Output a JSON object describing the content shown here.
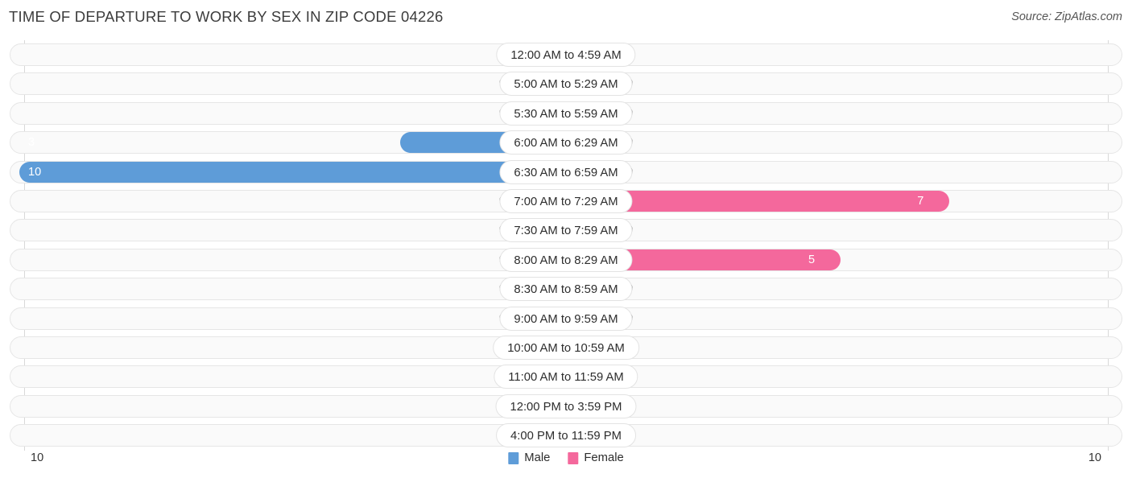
{
  "header": {
    "title": "TIME OF DEPARTURE TO WORK BY SEX IN ZIP CODE 04226",
    "source": "Source: ZipAtlas.com"
  },
  "legend": {
    "items": [
      {
        "label": "Male",
        "color": "#5e9cd8"
      },
      {
        "label": "Female",
        "color": "#f4689c"
      }
    ]
  },
  "axis": {
    "left_tick": "10",
    "right_tick": "10"
  },
  "colors": {
    "male_light": "#aecbee",
    "male_dark": "#5e9cd8",
    "female_light": "#f9aec8",
    "female_dark": "#f4689c",
    "track": "#fafafa",
    "track_border": "#e6e6e6"
  },
  "chart_data": {
    "type": "bar",
    "title": "TIME OF DEPARTURE TO WORK BY SEX IN ZIP CODE 04226",
    "orientation": "horizontal-diverging",
    "xlabel": "",
    "ylabel": "",
    "xlim": [
      10,
      10
    ],
    "grid": false,
    "legend_position": "bottom-center",
    "categories": [
      "12:00 AM to 4:59 AM",
      "5:00 AM to 5:29 AM",
      "5:30 AM to 5:59 AM",
      "6:00 AM to 6:29 AM",
      "6:30 AM to 6:59 AM",
      "7:00 AM to 7:29 AM",
      "7:30 AM to 7:59 AM",
      "8:00 AM to 8:29 AM",
      "8:30 AM to 8:59 AM",
      "9:00 AM to 9:59 AM",
      "10:00 AM to 10:59 AM",
      "11:00 AM to 11:59 AM",
      "12:00 PM to 3:59 PM",
      "4:00 PM to 11:59 PM"
    ],
    "series": [
      {
        "name": "Male",
        "values": [
          0,
          0,
          0,
          3,
          10,
          0,
          0,
          0,
          0,
          0,
          0,
          0,
          0,
          0
        ]
      },
      {
        "name": "Female",
        "values": [
          0,
          0,
          0,
          0,
          0,
          7,
          0,
          5,
          0,
          0,
          0,
          0,
          0,
          0
        ]
      }
    ]
  },
  "rows": [
    {
      "label": "12:00 AM to 4:59 AM",
      "male": "0",
      "female": "0"
    },
    {
      "label": "5:00 AM to 5:29 AM",
      "male": "0",
      "female": "0"
    },
    {
      "label": "5:30 AM to 5:59 AM",
      "male": "0",
      "female": "0"
    },
    {
      "label": "6:00 AM to 6:29 AM",
      "male": "3",
      "female": "0"
    },
    {
      "label": "6:30 AM to 6:59 AM",
      "male": "10",
      "female": "0"
    },
    {
      "label": "7:00 AM to 7:29 AM",
      "male": "0",
      "female": "7"
    },
    {
      "label": "7:30 AM to 7:59 AM",
      "male": "0",
      "female": "0"
    },
    {
      "label": "8:00 AM to 8:29 AM",
      "male": "0",
      "female": "5"
    },
    {
      "label": "8:30 AM to 8:59 AM",
      "male": "0",
      "female": "0"
    },
    {
      "label": "9:00 AM to 9:59 AM",
      "male": "0",
      "female": "0"
    },
    {
      "label": "10:00 AM to 10:59 AM",
      "male": "0",
      "female": "0"
    },
    {
      "label": "11:00 AM to 11:59 AM",
      "male": "0",
      "female": "0"
    },
    {
      "label": "12:00 PM to 3:59 PM",
      "male": "0",
      "female": "0"
    },
    {
      "label": "4:00 PM to 11:59 PM",
      "male": "0",
      "female": "0"
    }
  ]
}
